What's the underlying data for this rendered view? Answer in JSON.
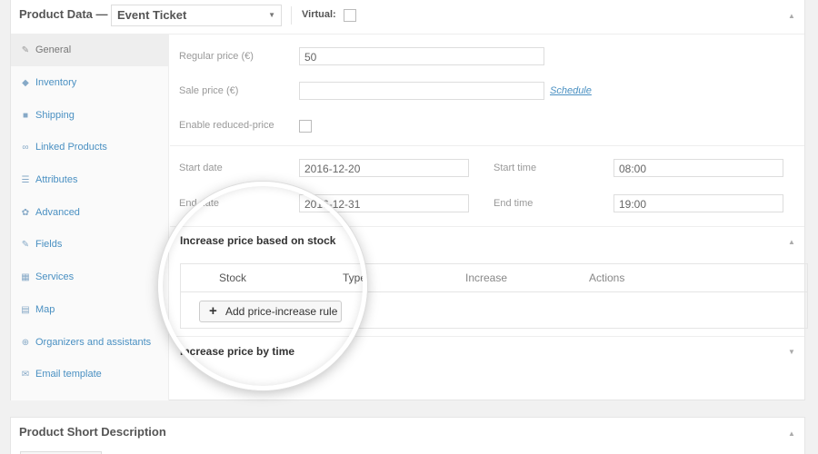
{
  "product_data": {
    "title": "Product Data —",
    "product_type": "Event Ticket",
    "virtual_label": "Virtual:"
  },
  "sidebar": {
    "items": [
      {
        "label": "General",
        "icon": "wrench-icon",
        "glyph": "✎"
      },
      {
        "label": "Inventory",
        "icon": "tag-icon",
        "glyph": "◆"
      },
      {
        "label": "Shipping",
        "icon": "truck-icon",
        "glyph": "■"
      },
      {
        "label": "Linked Products",
        "icon": "link-icon",
        "glyph": "∞"
      },
      {
        "label": "Attributes",
        "icon": "list-icon",
        "glyph": "☰"
      },
      {
        "label": "Advanced",
        "icon": "gear-icon",
        "glyph": "✿"
      },
      {
        "label": "Fields",
        "icon": "pencil-icon",
        "glyph": "✎"
      },
      {
        "label": "Services",
        "icon": "grid-icon",
        "glyph": "▦"
      },
      {
        "label": "Map",
        "icon": "map-icon",
        "glyph": "▤"
      },
      {
        "label": "Organizers and assistants",
        "icon": "globe-icon",
        "glyph": "⊕"
      },
      {
        "label": "Email template",
        "icon": "envelope-icon",
        "glyph": "✉"
      }
    ]
  },
  "general": {
    "regular_price_label": "Regular price (€)",
    "regular_price_value": "50",
    "sale_price_label": "Sale price (€)",
    "sale_price_value": "",
    "schedule_link": "Schedule",
    "reduced_price_label": "Enable reduced-price",
    "start_date_label": "Start date",
    "start_date_value": "2016-12-20",
    "start_time_label": "Start time",
    "start_time_value": "08:00",
    "end_date_label": "End date",
    "end_date_value": "2016-12-31",
    "end_time_label": "End time",
    "end_time_value": "19:00"
  },
  "stock_rules": {
    "title": "Increase price based on stock",
    "columns": [
      "Stock",
      "Type",
      "Increase",
      "Actions"
    ],
    "add_button": "Add price-increase rule"
  },
  "time_rules": {
    "title": "Increase price by time"
  },
  "short_description": {
    "title": "Product Short Description"
  }
}
